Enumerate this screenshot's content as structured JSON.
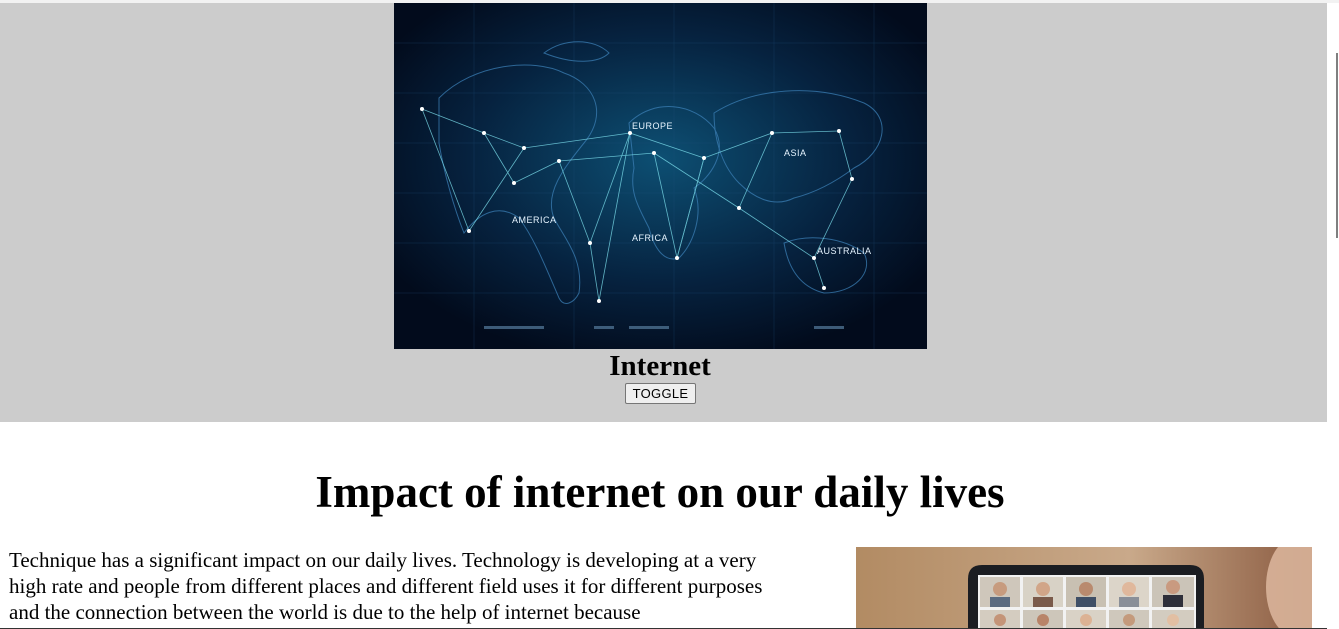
{
  "hero": {
    "image_alt": "World map network",
    "map_labels": {
      "europe": "EUROPE",
      "asia": "ASIA",
      "america": "AMERICA",
      "africa": "AFRICA",
      "australia": "AUSTRALIA"
    },
    "title": "Internet",
    "toggle_label": "TOGGLE"
  },
  "article": {
    "heading": "Impact of internet on our daily lives",
    "paragraph": "Technique has a significant impact on our daily lives. Technology is developing at a very high rate and people from different places and different field uses it for different purposes and the connection between the world is due to the help of internet because",
    "image_alt": "Video conference on laptop"
  },
  "colors": {
    "hero_background": "#cccccc",
    "map_background": "#020b1c",
    "network_line": "#7fe3f0"
  }
}
